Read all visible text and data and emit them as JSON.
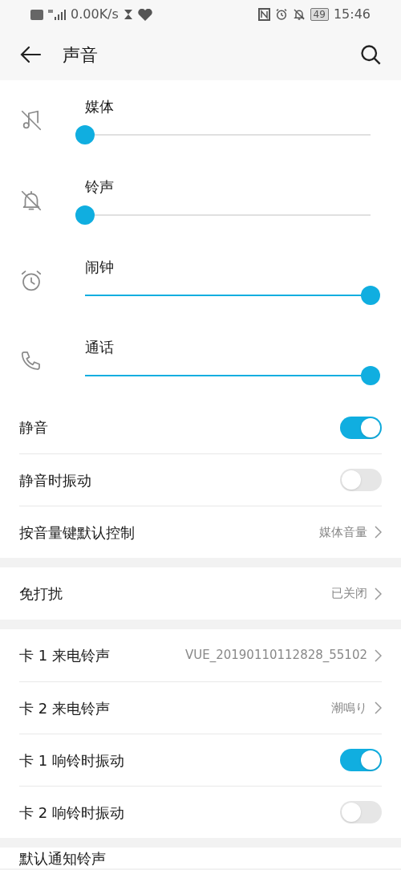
{
  "status_bar": {
    "network_speed": "0.00K/s",
    "battery": "49",
    "time": "15:46"
  },
  "header": {
    "title": "声音"
  },
  "volume_sliders": [
    {
      "kind": "media",
      "label": "媒体",
      "level": 0
    },
    {
      "kind": "ringtone",
      "label": "铃声",
      "level": 0
    },
    {
      "kind": "alarm",
      "label": "闹钟",
      "level": 1
    },
    {
      "kind": "call",
      "label": "通话",
      "level": 1
    }
  ],
  "sections": [
    {
      "rows": [
        {
          "kind": "toggle",
          "label": "静音",
          "on": true
        },
        {
          "kind": "toggle",
          "label": "静音时振动",
          "on": false
        },
        {
          "kind": "link",
          "label": "按音量键默认控制",
          "value": "媒体音量"
        }
      ]
    },
    {
      "rows": [
        {
          "kind": "link",
          "label": "免打扰",
          "value": "已关闭"
        }
      ]
    },
    {
      "rows": [
        {
          "kind": "link",
          "label": "卡 1 来电铃声",
          "value": "VUE_20190110112828_55102"
        },
        {
          "kind": "link",
          "label": "卡 2 来电铃声",
          "value": "潮鳴り"
        },
        {
          "kind": "toggle",
          "label": "卡 1 响铃时振动",
          "on": true
        },
        {
          "kind": "toggle",
          "label": "卡 2 响铃时振动",
          "on": false
        }
      ]
    },
    {
      "rows": [
        {
          "kind": "partial",
          "label": "默认通知铃声"
        }
      ]
    }
  ]
}
